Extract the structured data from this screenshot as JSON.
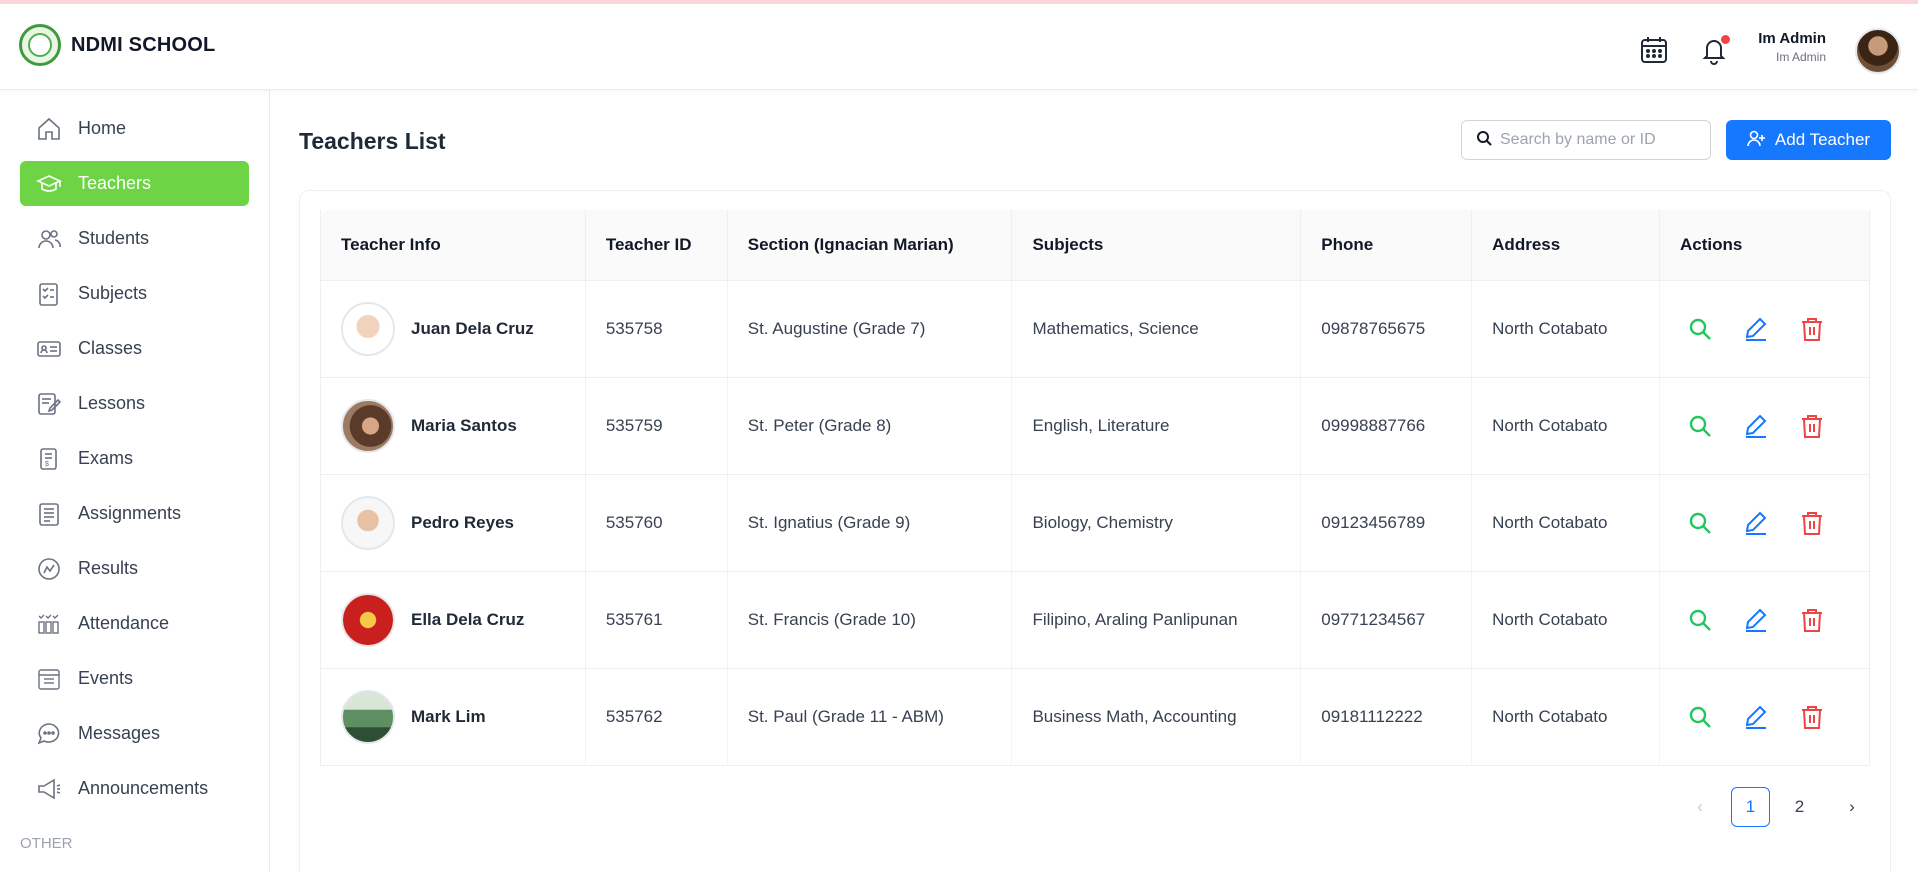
{
  "header": {
    "brand": "NDMI SCHOOL",
    "user_name": "Im Admin",
    "user_role": "Im Admin",
    "icons": [
      "calendar-icon",
      "bell-icon"
    ]
  },
  "sidebar": {
    "items": [
      {
        "label": "Home",
        "icon": "home-icon"
      },
      {
        "label": "Teachers",
        "icon": "graduation-cap-icon",
        "active": true
      },
      {
        "label": "Students",
        "icon": "users-icon"
      },
      {
        "label": "Subjects",
        "icon": "checklist-icon"
      },
      {
        "label": "Classes",
        "icon": "id-card-icon"
      },
      {
        "label": "Lessons",
        "icon": "edit-note-icon"
      },
      {
        "label": "Exams",
        "icon": "scroll-icon"
      },
      {
        "label": "Assignments",
        "icon": "document-icon"
      },
      {
        "label": "Results",
        "icon": "chart-circle-icon"
      },
      {
        "label": "Attendance",
        "icon": "attendance-icon"
      },
      {
        "label": "Events",
        "icon": "calendar-icon"
      },
      {
        "label": "Messages",
        "icon": "chat-icon"
      },
      {
        "label": "Announcements",
        "icon": "megaphone-icon"
      }
    ],
    "other_label": "OTHER"
  },
  "main": {
    "title": "Teachers List",
    "search_placeholder": "Search by name or ID",
    "add_button": "Add Teacher",
    "table": {
      "columns": [
        "Teacher Info",
        "Teacher ID",
        "Section (Ignacian Marian)",
        "Subjects",
        "Phone",
        "Address",
        "Actions"
      ],
      "rows": [
        {
          "name": "Juan Dela Cruz",
          "id": "535758",
          "section": "St. Augustine (Grade 7)",
          "subjects": "Mathematics, Science",
          "phone": "09878765675",
          "address": "North Cotabato"
        },
        {
          "name": "Maria Santos",
          "id": "535759",
          "section": "St. Peter (Grade 8)",
          "subjects": "English, Literature",
          "phone": "09998887766",
          "address": "North Cotabato"
        },
        {
          "name": "Pedro Reyes",
          "id": "535760",
          "section": "St. Ignatius (Grade 9)",
          "subjects": "Biology, Chemistry",
          "phone": "09123456789",
          "address": "North Cotabato"
        },
        {
          "name": "Ella Dela Cruz",
          "id": "535761",
          "section": "St. Francis (Grade 10)",
          "subjects": "Filipino, Araling Panlipunan",
          "phone": "09771234567",
          "address": "North Cotabato"
        },
        {
          "name": "Mark Lim",
          "id": "535762",
          "section": "St. Paul (Grade 11 - ABM)",
          "subjects": "Business Math, Accounting",
          "phone": "09181112222",
          "address": "North Cotabato"
        }
      ]
    },
    "pagination": {
      "pages": [
        "1",
        "2"
      ],
      "current": "1",
      "prev": "‹",
      "next": "›"
    }
  },
  "colors": {
    "accent_green": "#6dd545",
    "primary_blue": "#1677ff",
    "danger_red": "#ef4444",
    "view_green": "#22c55e"
  }
}
